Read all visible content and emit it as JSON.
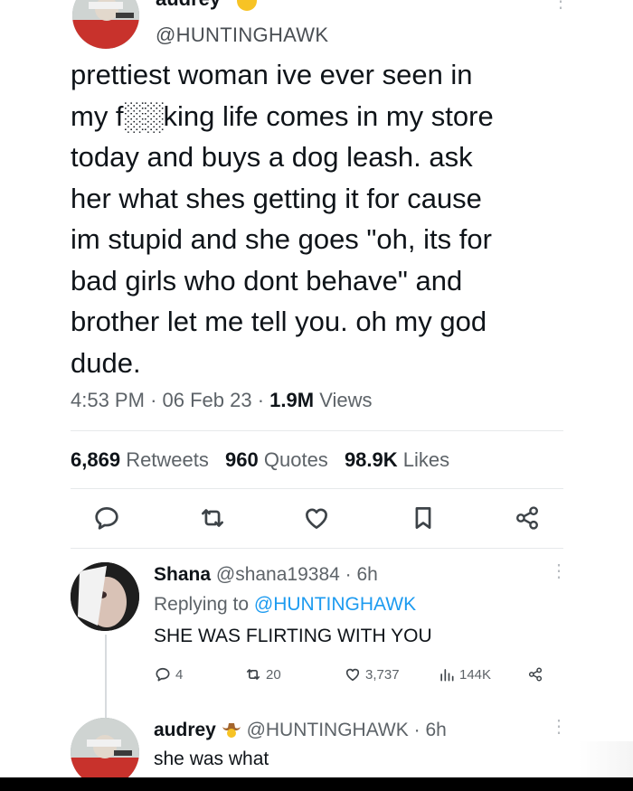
{
  "main_tweet": {
    "author_name": "audrey",
    "handle": "@HUNTINGHAWK",
    "text": "prettiest woman ive ever seen in\nmy f░░king life comes in my store\ntoday and buys a dog leash. ask\nher what shes getting it for cause\nim stupid and she goes \"oh, its for\nbad girls who dont behave\" and\nbrother let me tell you. oh my god\ndude.",
    "time": "4:53 PM",
    "date": "06 Feb 23",
    "views_count": "1.9M",
    "views_label": "Views",
    "retweets_count": "6,869",
    "retweets_label": "Retweets",
    "quotes_count": "960",
    "quotes_label": "Quotes",
    "likes_count": "98.9K",
    "likes_label": "Likes"
  },
  "reply_1": {
    "name": "Shana",
    "handle": "@shana19384",
    "age": "6h",
    "replying_label": "Replying to",
    "replying_to": "@HUNTINGHAWK",
    "text": "SHE WAS FLIRTING WITH YOU",
    "reply_count": "4",
    "retweet_count": "20",
    "like_count": "3,737",
    "views_count": "144K"
  },
  "reply_2": {
    "name": "audrey",
    "handle": "@HUNTINGHAWK",
    "age": "6h",
    "text": "she was what"
  },
  "separator": "·",
  "colors": {
    "text": "#0f1419",
    "secondary": "#5d6368",
    "link": "#1d9bf0",
    "divider": "#e6e9eb"
  },
  "icons": [
    "reply-icon",
    "retweet-icon",
    "like-icon",
    "bookmark-icon",
    "share-icon",
    "views-icon",
    "more-icon",
    "cowboy-emoji-icon",
    "smile-emoji-icon"
  ]
}
